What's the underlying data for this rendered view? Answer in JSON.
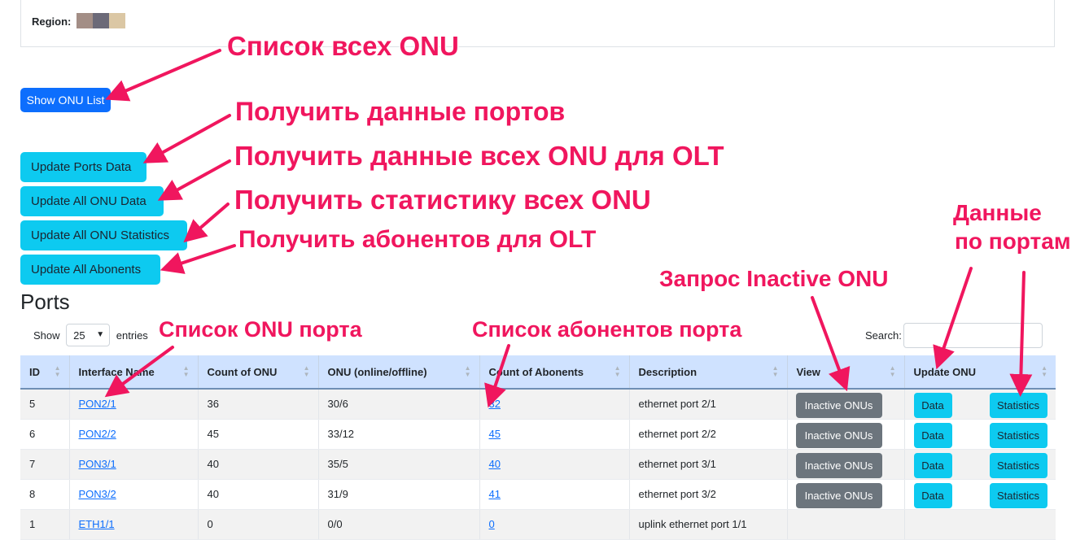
{
  "region": {
    "label": "Region:",
    "swatches": [
      "#a38e86",
      "#6c6a78",
      "#dbc7a4"
    ]
  },
  "buttons": {
    "show_onu_list": "Show ONU List",
    "update_ports_data": "Update Ports Data",
    "update_all_onu_data": "Update All ONU Data",
    "update_all_onu_statistics": "Update All ONU Statistics",
    "update_all_abonents": "Update All Abonents"
  },
  "ports": {
    "title": "Ports",
    "show_label": "Show",
    "entries_value": "25",
    "entries_label": "entries",
    "search_label": "Search:",
    "search_value": "",
    "columns": [
      "ID",
      "Interface Name",
      "Count of ONU",
      "ONU (online/offline)",
      "Count of Abonents",
      "Description",
      "View",
      "Update ONU"
    ],
    "rows": [
      {
        "id": "5",
        "iface": "PON2/1",
        "count": "36",
        "onu": "30/6",
        "abonents": "32",
        "desc": "ethernet port 2/1",
        "view_btn": "Inactive ONUs",
        "data_btn": "Data",
        "stats_btn": "Statistics"
      },
      {
        "id": "6",
        "iface": "PON2/2",
        "count": "45",
        "onu": "33/12",
        "abonents": "45",
        "desc": "ethernet port 2/2",
        "view_btn": "Inactive ONUs",
        "data_btn": "Data",
        "stats_btn": "Statistics"
      },
      {
        "id": "7",
        "iface": "PON3/1",
        "count": "40",
        "onu": "35/5",
        "abonents": "40",
        "desc": "ethernet port 3/1",
        "view_btn": "Inactive ONUs",
        "data_btn": "Data",
        "stats_btn": "Statistics"
      },
      {
        "id": "8",
        "iface": "PON3/2",
        "count": "40",
        "onu": "31/9",
        "abonents": "41",
        "desc": "ethernet port 3/2",
        "view_btn": "Inactive ONUs",
        "data_btn": "Data",
        "stats_btn": "Statistics"
      },
      {
        "id": "1",
        "iface": "ETH1/1",
        "count": "0",
        "onu": "0/0",
        "abonents": "0",
        "desc": "uplink ethernet port 1/1"
      }
    ]
  },
  "annotations": {
    "onu_list": "Список всех ONU",
    "ports_data": "Получить данные портов",
    "all_onu_data": "Получить данные всех ONU для OLT",
    "all_onu_stats": "Получить статистику всех ONU",
    "abonents": "Получить абонентов для OLT",
    "port_onu_list": "Список ONU порта",
    "port_abonents": "Список абонентов порта",
    "inactive": "Запрос Inactive ONU",
    "by_ports_1": "Данные",
    "by_ports_2": "по портам"
  },
  "colors": {
    "annotation": "#f0165e",
    "primary": "#0d6efd",
    "info": "#0dcaf0",
    "secondary": "#6c757d",
    "table_header": "#cfe2ff"
  }
}
